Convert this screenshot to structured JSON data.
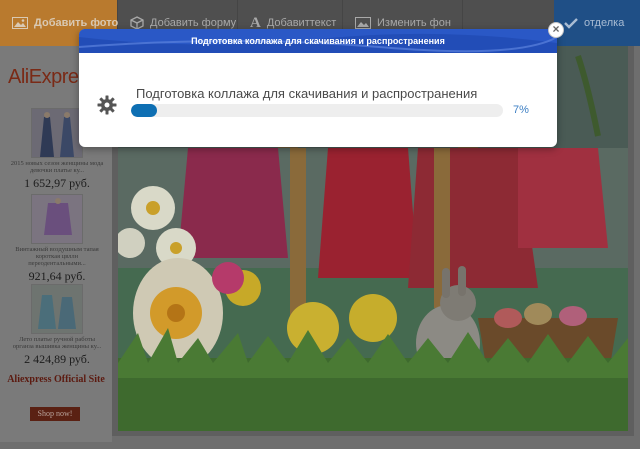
{
  "toolbar": {
    "add_photo": "Добавить фото",
    "add_shape": "Добавить форму",
    "add_text": "Добавиттекст",
    "change_bg": "Изменить фон",
    "done": "отделка"
  },
  "ad": {
    "logo": "AliExpre",
    "items": [
      {
        "desc": "2015 новых сезон женщины мода девочки платье ку...",
        "price": "1 652,97 руб."
      },
      {
        "desc": "Винтажный воздушным тапая короткая цвллн переодентальными...",
        "price": "921,64 руб."
      },
      {
        "desc": "Лето платье ручной работы органза вышивка женщины ку...",
        "price": "2 424,89 руб."
      }
    ],
    "title": "Aliexpress Official Site",
    "shop_button": "Shop now!"
  },
  "dialog": {
    "title": "Подготовка коллажа для скачивания и распространения",
    "message": "Подготовка коллажа для скачивания и распространения",
    "progress_percent": 7,
    "progress_label": "7%",
    "close_label": "×"
  },
  "colors": {
    "toolbar_bg": "#4f4f4f",
    "add_button": "#b97a2e",
    "done_button": "#1f4f86",
    "dialog_header": "#2a58c6",
    "progress_fill": "#0e6fb3",
    "percent_text": "#3d7fc4"
  },
  "icons": {
    "add_photo": "image-icon",
    "add_shape": "cube-icon",
    "add_text": "letter-a-icon",
    "change_bg": "image-icon",
    "done": "checkmark-icon",
    "dialog_status": "gear-icon",
    "close": "close-icon"
  }
}
